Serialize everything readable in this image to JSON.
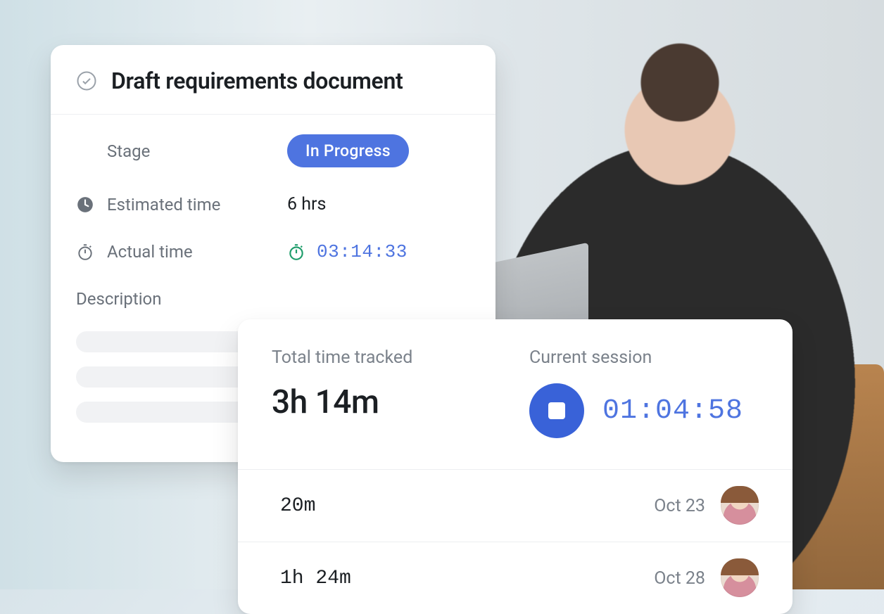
{
  "task": {
    "title": "Draft requirements document",
    "stage_label": "Stage",
    "stage_value": "In Progress",
    "estimated_label": "Estimated time",
    "estimated_value": "6 hrs",
    "actual_label": "Actual time",
    "actual_value": "03:14:33",
    "description_label": "Description"
  },
  "tracker": {
    "total_label": "Total time tracked",
    "total_value": "3h 14m",
    "session_label": "Current session",
    "session_value": "01:04:58",
    "logs": [
      {
        "duration": "20m",
        "date": "Oct 23"
      },
      {
        "duration": "1h 24m",
        "date": "Oct 28"
      }
    ]
  },
  "colors": {
    "accent": "#4e74e0",
    "text_muted": "#6a717a",
    "timer_running": "#1f9d6b"
  }
}
